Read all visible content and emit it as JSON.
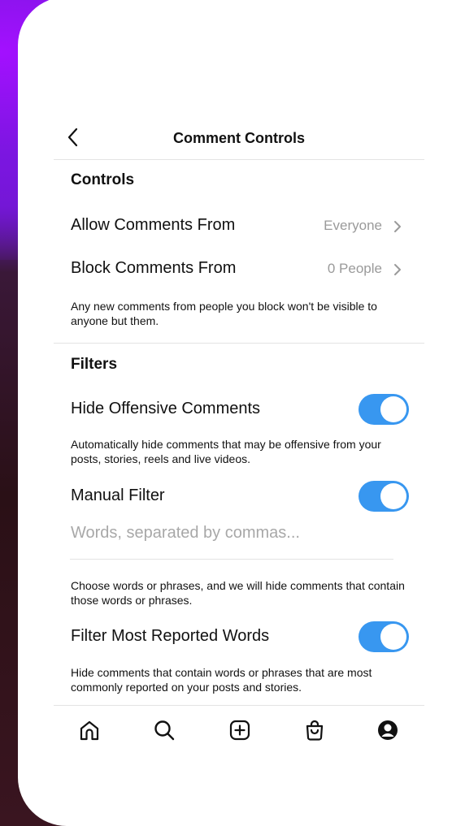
{
  "header": {
    "title": "Comment Controls"
  },
  "controls": {
    "section_title": "Controls",
    "allow_comments": {
      "label": "Allow Comments From",
      "value": "Everyone"
    },
    "block_comments": {
      "label": "Block Comments From",
      "value": "0 People"
    },
    "block_description": "Any new comments from people you block won't be visible to anyone but them."
  },
  "filters": {
    "section_title": "Filters",
    "hide_offensive": {
      "label": "Hide Offensive Comments",
      "enabled": true,
      "description": "Automatically hide comments that may be offensive from your posts, stories, reels and live videos."
    },
    "manual_filter": {
      "label": "Manual Filter",
      "enabled": true,
      "placeholder": "Words, separated by commas...",
      "description": "Choose words or phrases, and we will hide comments that contain those words or phrases."
    },
    "most_reported": {
      "label": "Filter Most Reported Words",
      "enabled": true,
      "description": "Hide comments that contain words or phrases that are most commonly reported on your posts and stories."
    }
  },
  "colors": {
    "toggle_on": "#3897f0",
    "text": "#111111",
    "muted": "#9a9a9a"
  },
  "nav": [
    "home-icon",
    "search-icon",
    "add-post-icon",
    "shop-icon",
    "profile-icon"
  ]
}
